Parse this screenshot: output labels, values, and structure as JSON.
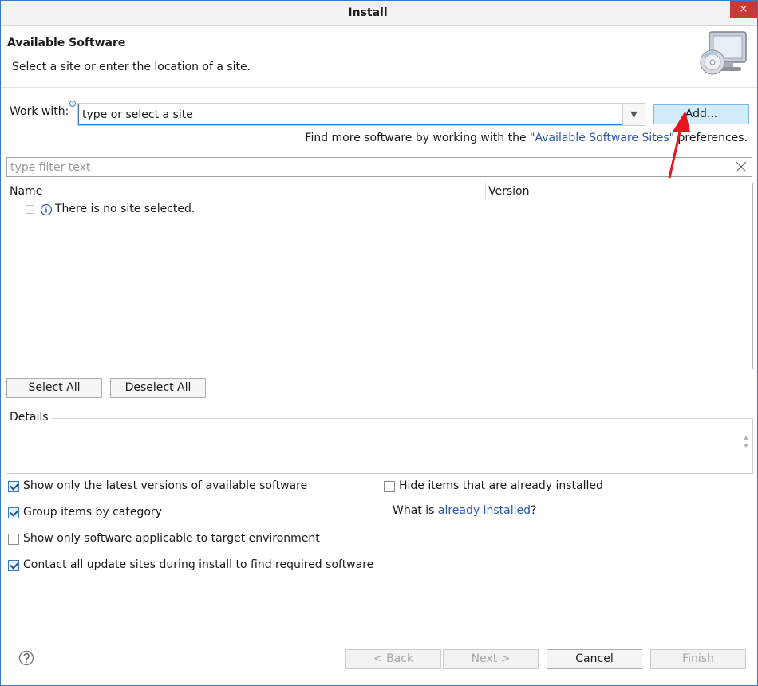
{
  "window": {
    "title": "Install",
    "close_glyph": "×"
  },
  "banner": {
    "heading": "Available Software",
    "description": "Select a site or enter the location of a site.",
    "icon": "monitor-cd-icon"
  },
  "work_with": {
    "label": "Work with:",
    "value": "type or select a site",
    "dropdown_glyph": "▼",
    "add_button": "Add..."
  },
  "more_software": {
    "prefix": "Find more software by working with the ",
    "link": "\"Available Software Sites\"",
    "suffix": " preferences."
  },
  "filter": {
    "placeholder": "type filter text"
  },
  "tree": {
    "columns": [
      "Name",
      "Version"
    ],
    "rows": [
      {
        "name": "There is no site selected.",
        "version": ""
      }
    ]
  },
  "buttons": {
    "select_all": "Select All",
    "deselect_all": "Deselect All"
  },
  "details": {
    "label": "Details"
  },
  "options": {
    "latest_versions": {
      "label": "Show only the latest versions of available software",
      "checked": true
    },
    "group_by_category": {
      "label": "Group items by category",
      "checked": true
    },
    "target_env": {
      "label": "Show only software applicable to target environment",
      "checked": false
    },
    "contact_sites": {
      "label": "Contact all update sites during install to find required software",
      "checked": true
    },
    "hide_installed": {
      "label": "Hide items that are already installed",
      "checked": false
    }
  },
  "installed_q": {
    "prefix": "What is ",
    "link": "already installed",
    "suffix": "?"
  },
  "footer": {
    "back": "< Back",
    "next": "Next >",
    "cancel": "Cancel",
    "finish": "Finish"
  },
  "colors": {
    "accent": "#3a78c2",
    "link": "#2a57a6",
    "hover_button": "#d3ecfb",
    "annotation": "#e8141c"
  }
}
